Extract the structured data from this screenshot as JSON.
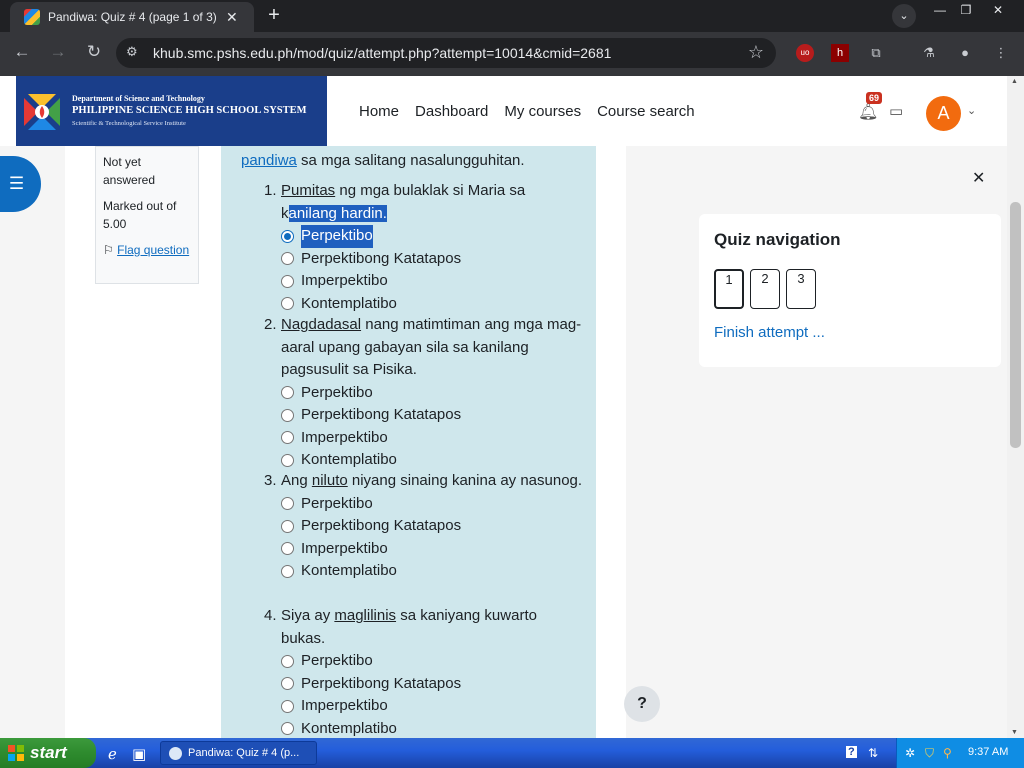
{
  "browser": {
    "tab_title": "Pandiwa: Quiz # 4 (page 1 of 3) |",
    "url": "khub.smc.pshs.edu.ph/mod/quiz/attempt.php?attempt=10014&cmid=2681"
  },
  "header": {
    "logo": {
      "line1": "Department of Science and Technology",
      "line2": "PHILIPPINE SCIENCE HIGH SCHOOL SYSTEM",
      "line3": "Scientific & Technological Service Institute"
    },
    "nav": [
      "Home",
      "Dashboard",
      "My courses",
      "Course search"
    ],
    "notification_count": "69",
    "avatar_initial": "A"
  },
  "question_info": {
    "status": "Not yet answered",
    "marks": "Marked out of 5.00",
    "flag": "Flag question"
  },
  "intro": {
    "link": "pandiwa",
    "rest": " sa mga salitang nasalungguhitan."
  },
  "questions": [
    {
      "num": "1.",
      "before": "",
      "underlined": "Pumitas",
      "after": " ng mga bulaklak si Maria sa kanilang hardin.",
      "options": [
        "Perpektibo",
        "Perpektibong Katatapos",
        "Imperpektibo",
        "Kontemplatibo"
      ],
      "selected": 0
    },
    {
      "num": "2.",
      "before": "",
      "underlined": "Nagdadasal",
      "after": " nang matimtiman ang mga mag-aaral upang gabayan sila sa kanilang pagsusulit sa Pisika.",
      "options": [
        "Perpektibo",
        "Perpektibong Katatapos",
        "Imperpektibo",
        "Kontemplatibo"
      ],
      "selected": -1
    },
    {
      "num": "3.",
      "before": "Ang ",
      "underlined": "niluto",
      "after": " niyang sinaing kanina ay nasunog.",
      "options": [
        "Perpektibo",
        "Perpektibong Katatapos",
        "Imperpektibo",
        "Kontemplatibo"
      ],
      "selected": -1
    },
    {
      "num": "4.",
      "before": "Siya ay ",
      "underlined": "maglilinis",
      "after": " sa kaniyang kuwarto bukas.",
      "options": [
        "Perpektibo",
        "Perpektibong Katatapos",
        "Imperpektibo",
        "Kontemplatibo"
      ],
      "selected": -1
    }
  ],
  "quiz_nav": {
    "title": "Quiz navigation",
    "pages": [
      "1",
      "2",
      "3"
    ],
    "finish": "Finish attempt ..."
  },
  "help": "?",
  "taskbar": {
    "start": "start",
    "task": "Pandiwa: Quiz # 4 (p...",
    "time": "9:37 AM"
  }
}
